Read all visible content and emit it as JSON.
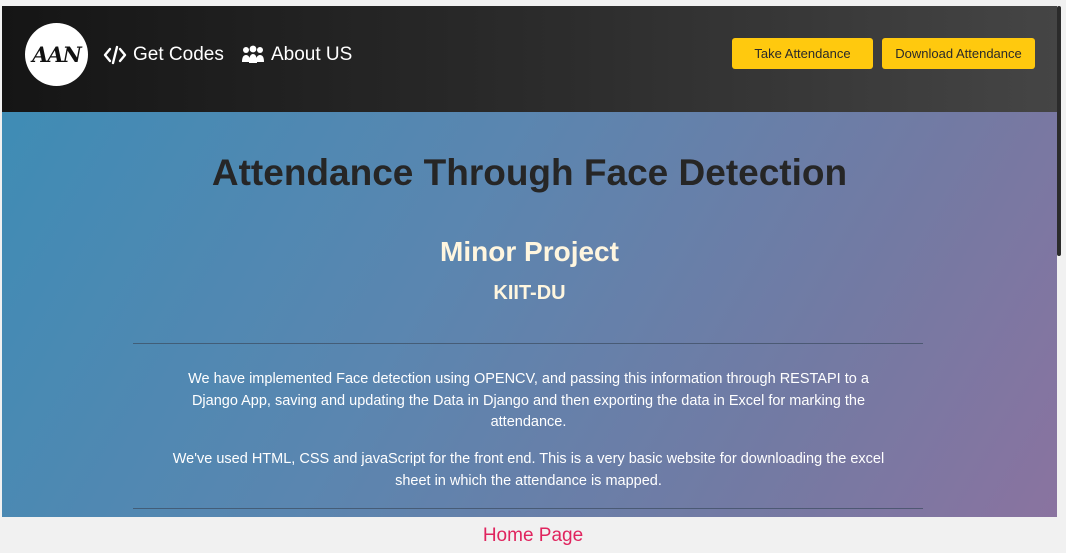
{
  "navbar": {
    "logo_text": "AAN",
    "links": [
      {
        "label": "Get Codes",
        "icon": "code-icon"
      },
      {
        "label": "About US",
        "icon": "users-icon"
      }
    ],
    "buttons": {
      "take_attendance": "Take Attendance",
      "download_attendance": "Download Attendance"
    }
  },
  "hero": {
    "title": "Attendance Through Face Detection",
    "subtitle": "Minor Project",
    "org": "KIIT-DU",
    "paragraphs": [
      "We have implemented Face detection using OPENCV, and passing this information through RESTAPI to a Django App, saving and updating the Data in Django and then exporting the data in Excel for marking the attendance.",
      "We've used HTML, CSS and javaScript for the front end. This is a very basic website for downloading the excel sheet in which the attendance is mapped."
    ]
  },
  "caption": "Home Page",
  "colors": {
    "accent": "#ffc90e",
    "navbar": "#1e1e1e",
    "caption": "#e0245e"
  }
}
